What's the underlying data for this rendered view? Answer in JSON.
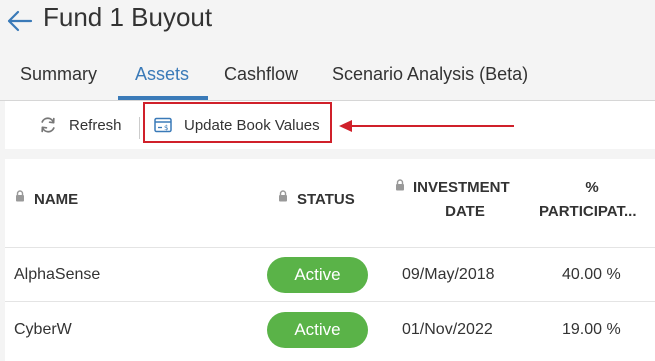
{
  "header": {
    "title": "Fund 1 Buyout",
    "back_icon": "arrow-left-icon"
  },
  "tabs": [
    {
      "label": "Summary",
      "active": false
    },
    {
      "label": "Assets",
      "active": true
    },
    {
      "label": "Cashflow",
      "active": false
    },
    {
      "label": "Scenario Analysis (Beta)",
      "active": false
    }
  ],
  "toolbar": {
    "refresh_label": "Refresh",
    "refresh_icon": "refresh-icon",
    "update_label": "Update Book Values",
    "update_icon": "book-values-icon"
  },
  "table": {
    "columns": [
      {
        "label": "NAME",
        "locked": true
      },
      {
        "label": "STATUS",
        "locked": true
      },
      {
        "label_line1": "INVESTMENT",
        "label_line2": "DATE",
        "locked": true
      },
      {
        "label_line1": "%",
        "label_line2": "PARTICIPAT...",
        "locked": false
      }
    ],
    "rows": [
      {
        "name": "AlphaSense",
        "status": "Active",
        "investment_date": "09/May/2018",
        "participation": "40.00 %"
      },
      {
        "name": "CyberW",
        "status": "Active",
        "investment_date": "01/Nov/2022",
        "participation": "19.00 %"
      }
    ]
  },
  "colors": {
    "accent": "#3a7ab8",
    "active_badge": "#5ab348",
    "annotation": "#d0202a"
  }
}
